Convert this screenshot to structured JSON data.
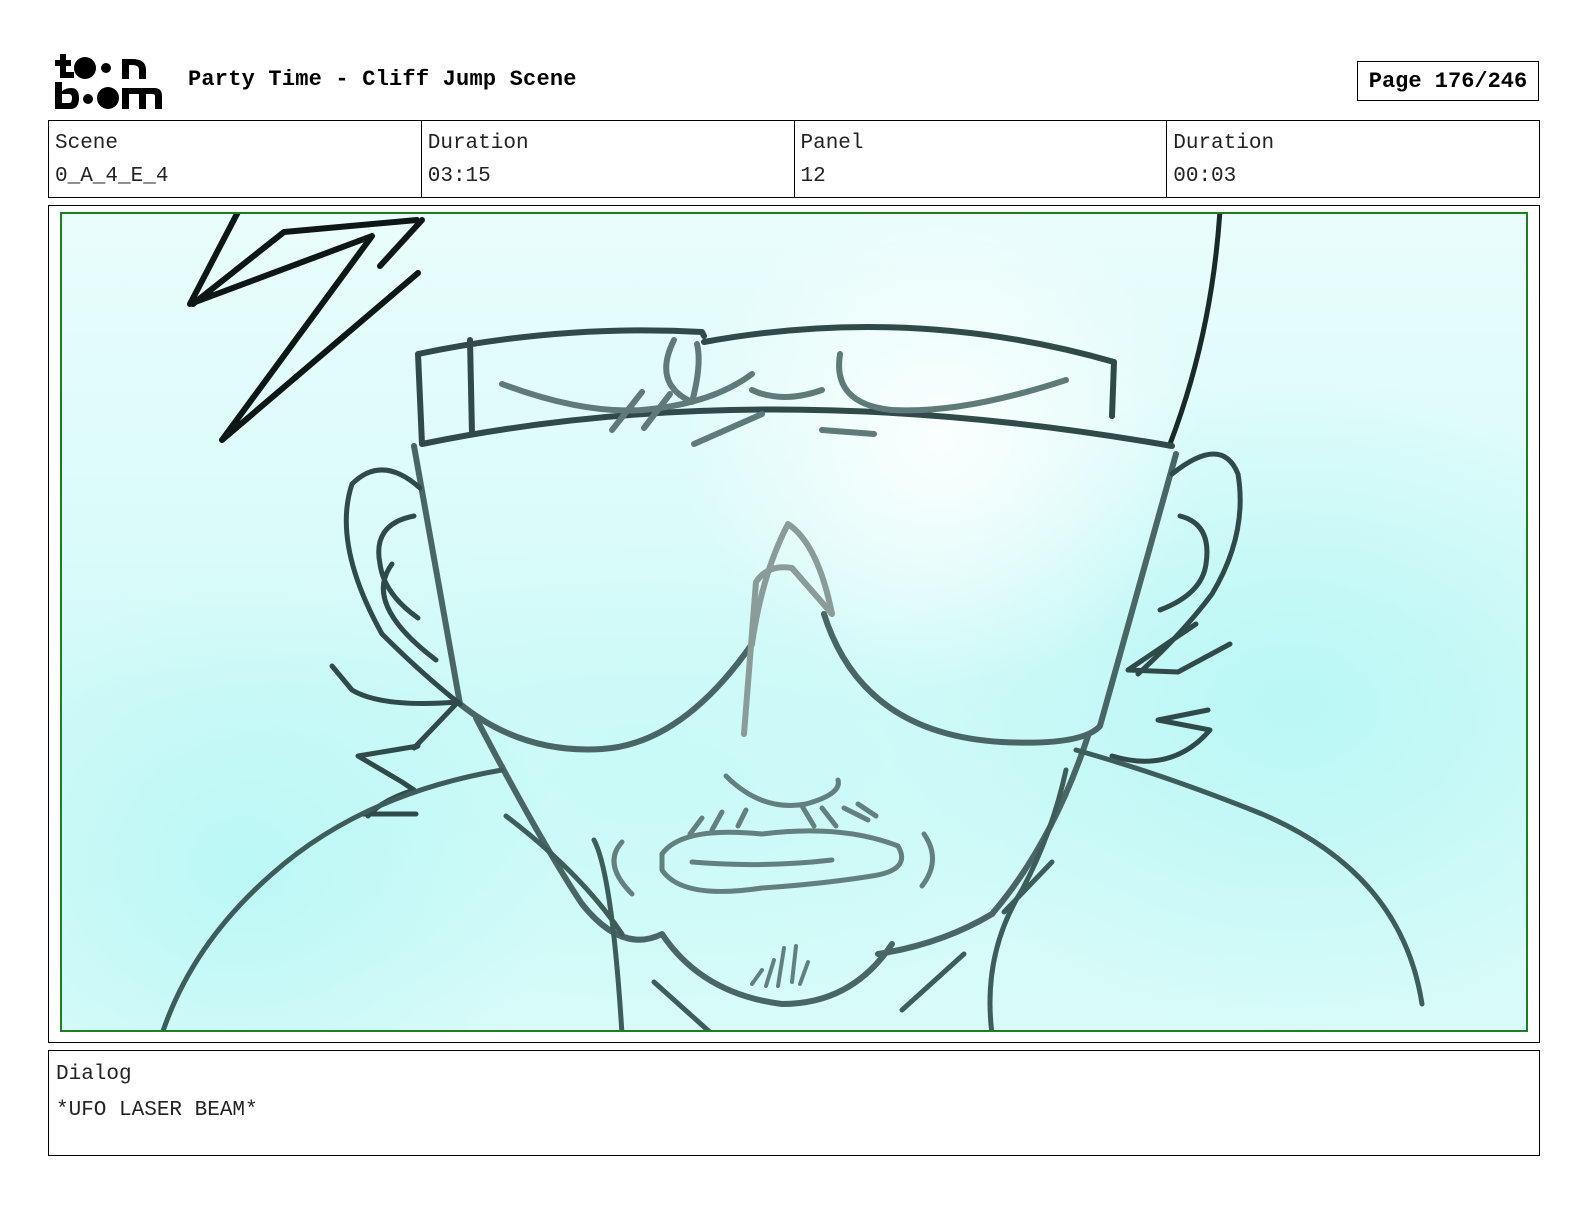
{
  "header": {
    "logo_text": "toon boom",
    "project_title": "Party Time - Cliff Jump Scene",
    "page_indicator": "Page 176/246"
  },
  "info": [
    {
      "label": "Scene",
      "value": "0_A_4_E_4"
    },
    {
      "label": "Duration",
      "value": "03:15"
    },
    {
      "label": "Panel",
      "value": "12"
    },
    {
      "label": "Duration",
      "value": "00:03"
    }
  ],
  "panel": {
    "frame_color": "#1e7d25",
    "drawing_line_color": "#4a6d6b",
    "background_color": "#d2faf8"
  },
  "dialog": {
    "label": "Dialog",
    "text": "*UFO LASER BEAM*"
  }
}
